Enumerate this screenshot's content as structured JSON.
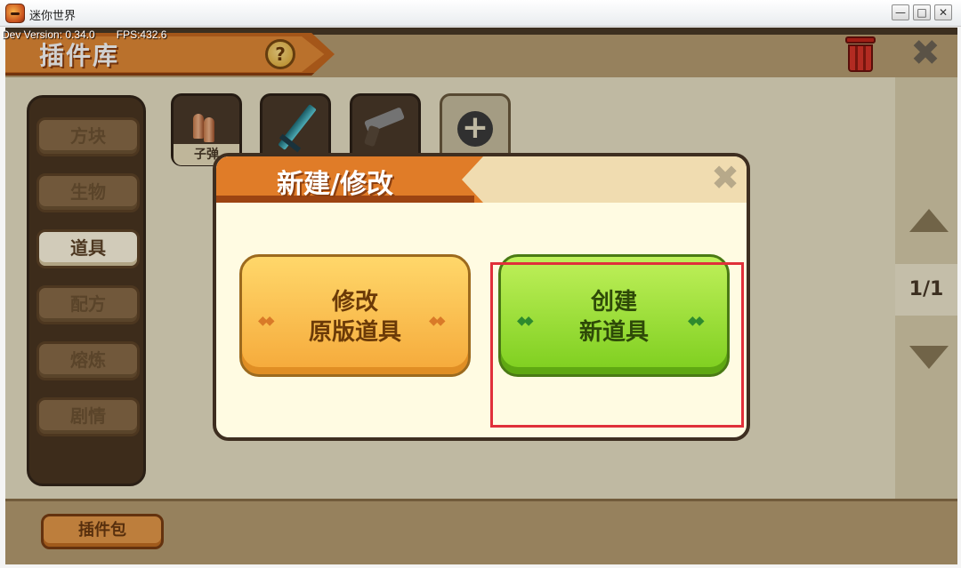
{
  "window": {
    "title": "迷你世界",
    "minimize": "—",
    "maximize": "□",
    "close": "✕"
  },
  "debug": {
    "version": "Dev Version: 0.34.0",
    "fps": "FPS:432.6"
  },
  "header": {
    "title": "插件库",
    "help": "?",
    "close_glyph": "✖"
  },
  "categories": [
    {
      "label": "方块"
    },
    {
      "label": "生物"
    },
    {
      "label": "道具",
      "active": true
    },
    {
      "label": "配方"
    },
    {
      "label": "熔炼"
    },
    {
      "label": "剧情"
    }
  ],
  "items": [
    {
      "label": "子弹"
    },
    {
      "label": ""
    },
    {
      "label": ""
    },
    {
      "add": "+"
    }
  ],
  "pager": {
    "page": "1/1"
  },
  "footer": {
    "plugin_pack": "插件包"
  },
  "modal": {
    "title": "新建/修改",
    "close_glyph": "✖",
    "option_modify": {
      "line1": "修改",
      "line2": "原版道具"
    },
    "option_create": {
      "line1": "创建",
      "line2": "新道具"
    }
  },
  "colors": {
    "highlight": "#e0303a",
    "accent_orange": "#e07c28",
    "accent_green": "#7dce1e"
  }
}
